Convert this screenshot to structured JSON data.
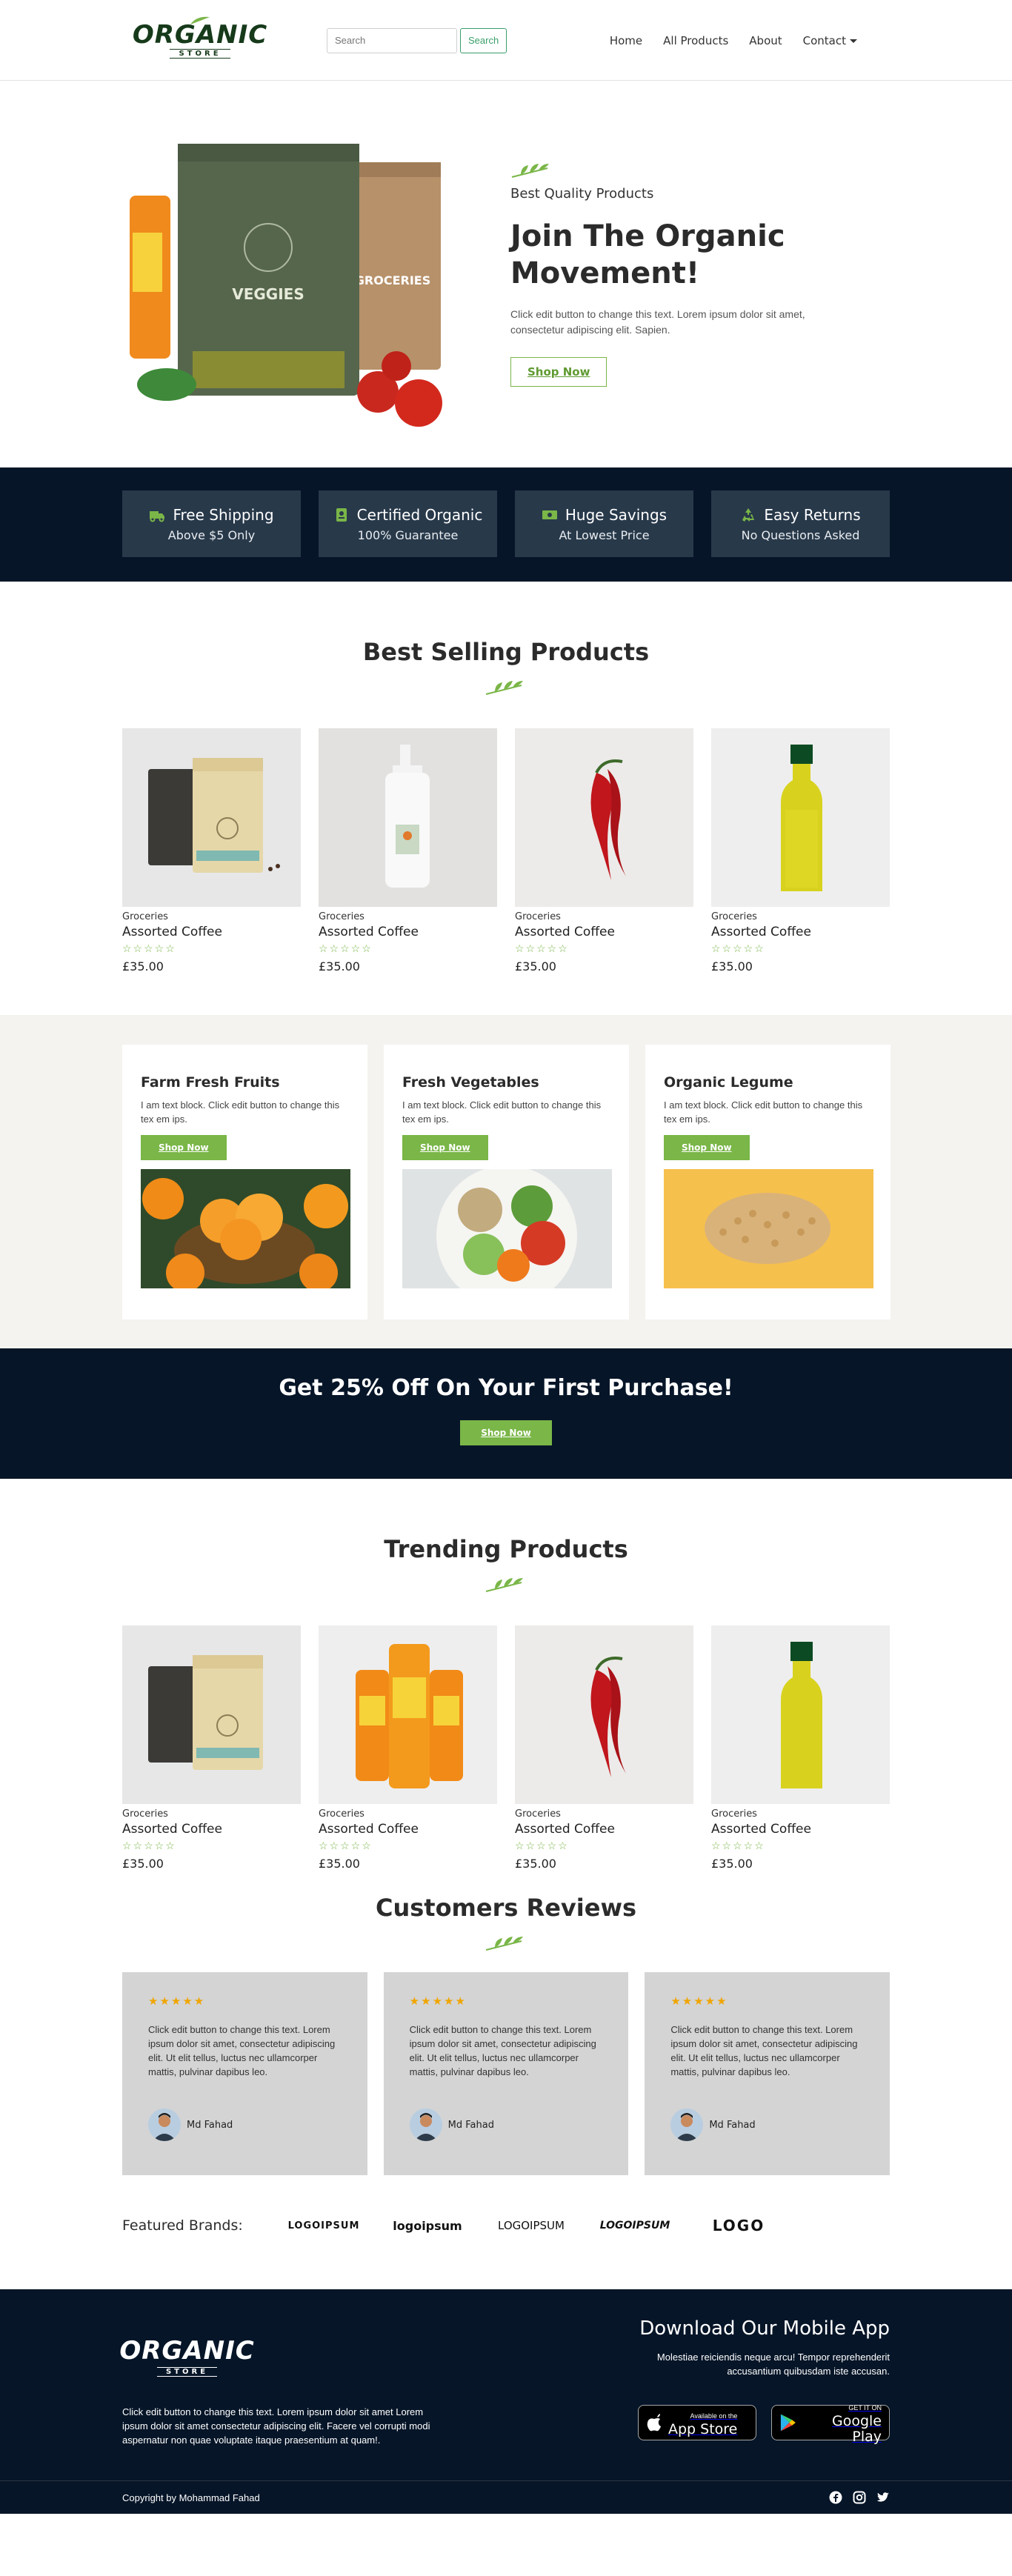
{
  "brand": {
    "logo_main": "ORGANIC",
    "logo_sub": "STORE"
  },
  "search": {
    "placeholder": "Search",
    "button": "Search"
  },
  "nav": {
    "items": [
      "Home",
      "All Products",
      "About",
      "Contact"
    ]
  },
  "hero": {
    "subtitle": "Best Quality Products",
    "title_line1": "Join The Organic",
    "title_line2": "Movement!",
    "desc_line1": "Click edit button to change this text. Lorem ipsum dolor sit amet,",
    "desc_line2": "consectetur adipiscing elit. Sapien.",
    "button": "Shop Now",
    "bag_label_1": "VEGGIES",
    "bag_label_2": "GROCERIES"
  },
  "features": [
    {
      "title": "Free Shipping",
      "sub": "Above $5 Only",
      "icon": "truck-icon"
    },
    {
      "title": "Certified Organic",
      "sub": "100% Guarantee",
      "icon": "certificate-icon"
    },
    {
      "title": "Huge Savings",
      "sub": "At Lowest Price",
      "icon": "money-icon"
    },
    {
      "title": "Easy Returns",
      "sub": "No Questions Asked",
      "icon": "recycle-icon"
    }
  ],
  "best_selling": {
    "title": "Best Selling Products",
    "products": [
      {
        "category": "Groceries",
        "name": "Assorted Coffee",
        "price": "£35.00",
        "image": "coffee-bags"
      },
      {
        "category": "Groceries",
        "name": "Assorted Coffee",
        "price": "£35.00",
        "image": "lotion-bottle"
      },
      {
        "category": "Groceries",
        "name": "Assorted Coffee",
        "price": "£35.00",
        "image": "red-chili"
      },
      {
        "category": "Groceries",
        "name": "Assorted Coffee",
        "price": "£35.00",
        "image": "oil-bottle"
      }
    ]
  },
  "categories": [
    {
      "title": "Farm Fresh Fruits",
      "desc": "I am text block. Click edit button to change this tex em ips.",
      "button": "Shop Now"
    },
    {
      "title": "Fresh Vegetables",
      "desc": "I am text block. Click edit button to change this tex em ips.",
      "button": "Shop Now"
    },
    {
      "title": "Organic Legume",
      "desc": "I am text block. Click edit button to change this tex em ips.",
      "button": "Shop Now"
    }
  ],
  "promo": {
    "title": "Get 25% Off On Your First Purchase!",
    "button": "Shop Now"
  },
  "trending": {
    "title": "Trending Products",
    "products": [
      {
        "category": "Groceries",
        "name": "Assorted Coffee",
        "price": "£35.00",
        "image": "coffee-bags"
      },
      {
        "category": "Groceries",
        "name": "Assorted Coffee",
        "price": "£35.00",
        "image": "juice-bottles"
      },
      {
        "category": "Groceries",
        "name": "Assorted Coffee",
        "price": "£35.00",
        "image": "red-chili"
      },
      {
        "category": "Groceries",
        "name": "Assorted Coffee",
        "price": "£35.00",
        "image": "oil-bottle"
      }
    ]
  },
  "reviews": {
    "title": "Customers Reviews",
    "items": [
      {
        "stars": "★★★★★",
        "text": "Click edit button to change this text. Lorem ipsum dolor sit amet, consectetur adipiscing elit. Ut elit tellus, luctus nec ullamcorper mattis, pulvinar dapibus leo.",
        "author": "Md Fahad"
      },
      {
        "stars": "★★★★★",
        "text": "Click edit button to change this text. Lorem ipsum dolor sit amet, consectetur adipiscing elit. Ut elit tellus, luctus nec ullamcorper mattis, pulvinar dapibus leo.",
        "author": "Md Fahad"
      },
      {
        "stars": "★★★★★",
        "text": "Click edit button to change this text. Lorem ipsum dolor sit amet, consectetur adipiscing elit. Ut elit tellus, luctus nec ullamcorper mattis, pulvinar dapibus leo.",
        "author": "Md Fahad"
      }
    ]
  },
  "brands": {
    "label": "Featured Brands:",
    "logos": [
      "LOGOIPSUM",
      "logoipsum",
      "LOGOIPSUM",
      "LOGOIPSUM",
      "LOGO"
    ]
  },
  "footer": {
    "desc": "Click edit button to change this text. Lorem ipsum dolor sit amet Lorem ipsum dolor sit amet consectetur adipiscing elit. Facere vel corrupti modi aspernatur non quae voluptate itaque praesentium at quam!.",
    "app_title": "Download Our Mobile App",
    "app_desc": "Molestiae reiciendis neque arcu! Tempor reprehenderit accusantium quibusdam iste accusan.",
    "appstore_small": "Available on the",
    "appstore_big": "App Store",
    "gplay_small": "GET IT ON",
    "gplay_big": "Google Play",
    "copyright": "Copyright by Mohammad Fahad",
    "social": [
      "facebook-icon",
      "instagram-icon",
      "twitter-icon"
    ]
  },
  "colors": {
    "accent": "#7ab648",
    "dark": "#061528",
    "feature_card": "#28394a",
    "review_card": "#d4d4d4",
    "category_bg": "#f4f3ef",
    "star_review": "#f0a500"
  }
}
